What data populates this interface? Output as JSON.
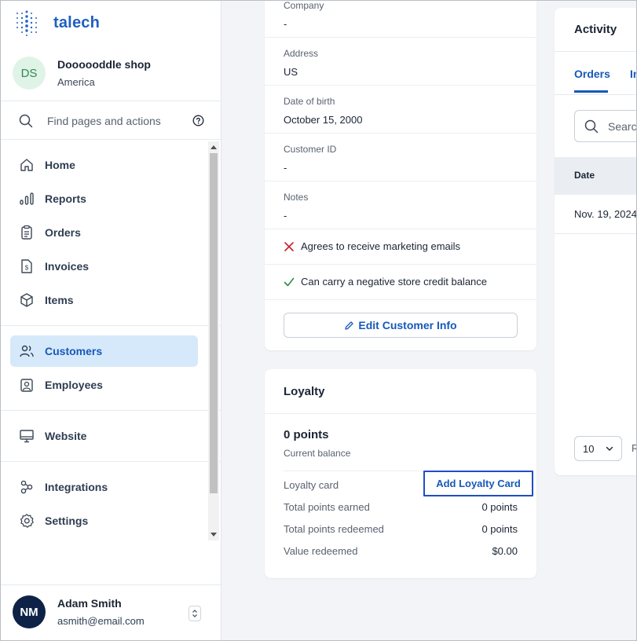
{
  "app": {
    "name": "talech",
    "brand_color": "#1f5fbf",
    "accent_color": "#1659b8"
  },
  "shop": {
    "initials": "DS",
    "name": "Doooooddle shop",
    "region": "America"
  },
  "search": {
    "placeholder": "Find pages and actions",
    "icon": "search-icon",
    "help_icon": "help-circle-icon"
  },
  "nav": {
    "items": [
      {
        "label": "Home",
        "icon": "home-icon",
        "active": false
      },
      {
        "label": "Reports",
        "icon": "bar-chart-icon",
        "active": false
      },
      {
        "label": "Orders",
        "icon": "clipboard-icon",
        "active": false
      },
      {
        "label": "Invoices",
        "icon": "invoice-icon",
        "active": false
      },
      {
        "label": "Items",
        "icon": "box-icon",
        "active": false
      },
      {
        "label": "Customers",
        "icon": "users-icon",
        "active": true
      },
      {
        "label": "Employees",
        "icon": "employee-badge-icon",
        "active": false
      },
      {
        "label": "Website",
        "icon": "monitor-icon",
        "active": false
      },
      {
        "label": "Integrations",
        "icon": "integrations-icon",
        "active": false
      },
      {
        "label": "Settings",
        "icon": "gear-icon",
        "active": false
      }
    ]
  },
  "user": {
    "initials": "NM",
    "name": "Adam Smith",
    "email": "asmith@email.com"
  },
  "customer": {
    "fields": [
      {
        "label": "Company",
        "value": "-"
      },
      {
        "label": "Address",
        "value": "US"
      },
      {
        "label": "Date of birth",
        "value": "October 15, 2000"
      },
      {
        "label": "Customer ID",
        "value": "-"
      },
      {
        "label": "Notes",
        "value": "-"
      }
    ],
    "marketing_emails": {
      "text": "Agrees to receive marketing emails",
      "checked": false
    },
    "negative_credit": {
      "text": "Can carry a negative store credit balance",
      "checked": true
    },
    "edit_label": "Edit Customer Info"
  },
  "loyalty": {
    "title": "Loyalty",
    "points": "0 points",
    "points_caption": "Current balance",
    "card_label": "Loyalty card",
    "add_card_label": "Add Loyalty Card",
    "rows": [
      {
        "label": "Total points earned",
        "value": "0 points"
      },
      {
        "label": "Total points redeemed",
        "value": "0 points"
      },
      {
        "label": "Value redeemed",
        "value": "$0.00"
      }
    ]
  },
  "activity": {
    "title": "Activity",
    "tabs": [
      "Orders",
      "In"
    ],
    "search_placeholder": "Search",
    "columns": [
      "Date"
    ],
    "rows": [
      {
        "date": "Nov. 19, 2024"
      }
    ],
    "page_size": "10",
    "pager_text": "R"
  }
}
